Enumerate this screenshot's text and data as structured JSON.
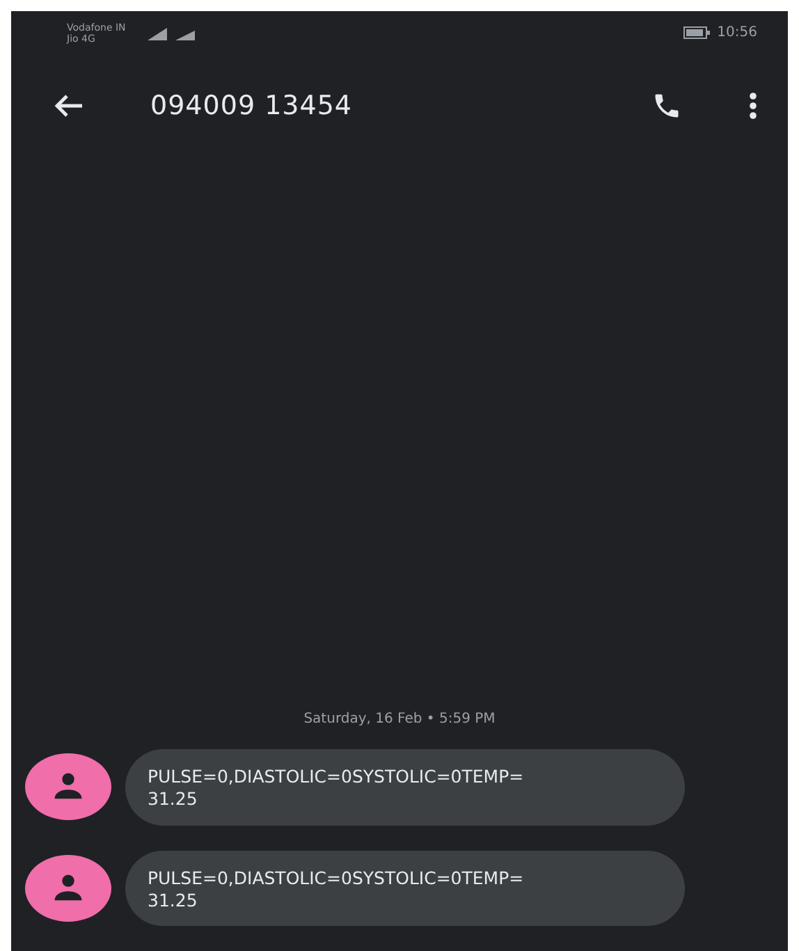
{
  "status_bar": {
    "carrier_1": "Vodafone IN",
    "carrier_2": "Jio 4G",
    "time": "10:56"
  },
  "header": {
    "title": "094009 13454"
  },
  "conversation": {
    "timestamp": "Saturday, 16 Feb • 5:59 PM",
    "messages": [
      {
        "lines": [
          "PULSE=0,DIASTOLIC=0SYSTOLIC=0TEMP=",
          "31.25"
        ],
        "color": "#f06eaa"
      },
      {
        "lines": [
          "PULSE=0,DIASTOLIC=0SYSTOLIC=0TEMP=",
          "31.25"
        ],
        "color": "#f06eaa"
      }
    ]
  }
}
